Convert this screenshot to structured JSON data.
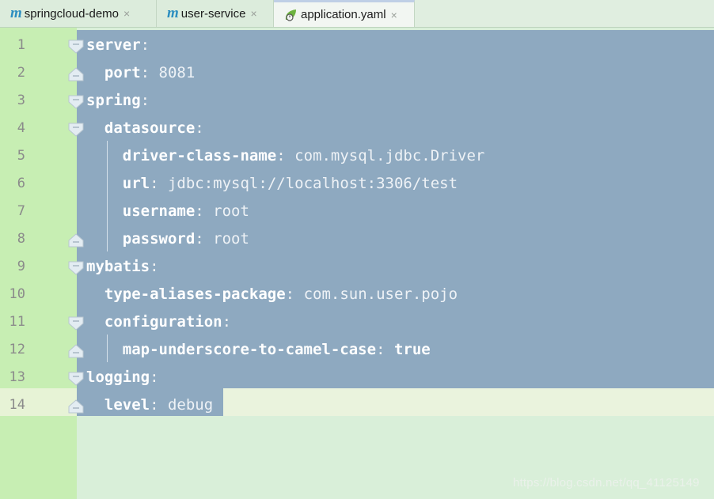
{
  "tabs": [
    {
      "icon": "m",
      "label": "springcloud-demo",
      "close": "×"
    },
    {
      "icon": "m",
      "label": "user-service",
      "close": "×"
    },
    {
      "icon": "spring-leaf",
      "label": "application.yaml",
      "close": "×"
    }
  ],
  "editor": {
    "lines": [
      {
        "num": "1",
        "key": "server",
        "sep": ":",
        "value": ""
      },
      {
        "num": "2",
        "key": "port",
        "sep": ": ",
        "value": "8081"
      },
      {
        "num": "3",
        "key": "spring",
        "sep": ":",
        "value": ""
      },
      {
        "num": "4",
        "key": "datasource",
        "sep": ":",
        "value": ""
      },
      {
        "num": "5",
        "key": "driver-class-name",
        "sep": ": ",
        "value": "com.mysql.jdbc.Driver"
      },
      {
        "num": "6",
        "key": "url",
        "sep": ": ",
        "value": "jdbc:mysql://localhost:3306/test"
      },
      {
        "num": "7",
        "key": "username",
        "sep": ": ",
        "value": "root"
      },
      {
        "num": "8",
        "key": "password",
        "sep": ": ",
        "value": "root"
      },
      {
        "num": "9",
        "key": "mybatis",
        "sep": ":",
        "value": ""
      },
      {
        "num": "10",
        "key": "type-aliases-package",
        "sep": ": ",
        "value": "com.sun.user.pojo"
      },
      {
        "num": "11",
        "key": "configuration",
        "sep": ":",
        "value": ""
      },
      {
        "num": "12",
        "key": "map-underscore-to-camel-case",
        "sep": ": ",
        "value": "true"
      },
      {
        "num": "13",
        "key": "logging",
        "sep": ":",
        "value": ""
      },
      {
        "num": "14",
        "key": "level",
        "sep": ": ",
        "value": "debug"
      }
    ]
  },
  "watermark": "https://blog.csdn.net/qq_41125149",
  "colors": {
    "selection": "#8ea9c0",
    "gutter": "#c7eeb3",
    "background": "#d9efd9",
    "m_icon": "#2c8ec0",
    "spring_icon": "#6db33f"
  }
}
